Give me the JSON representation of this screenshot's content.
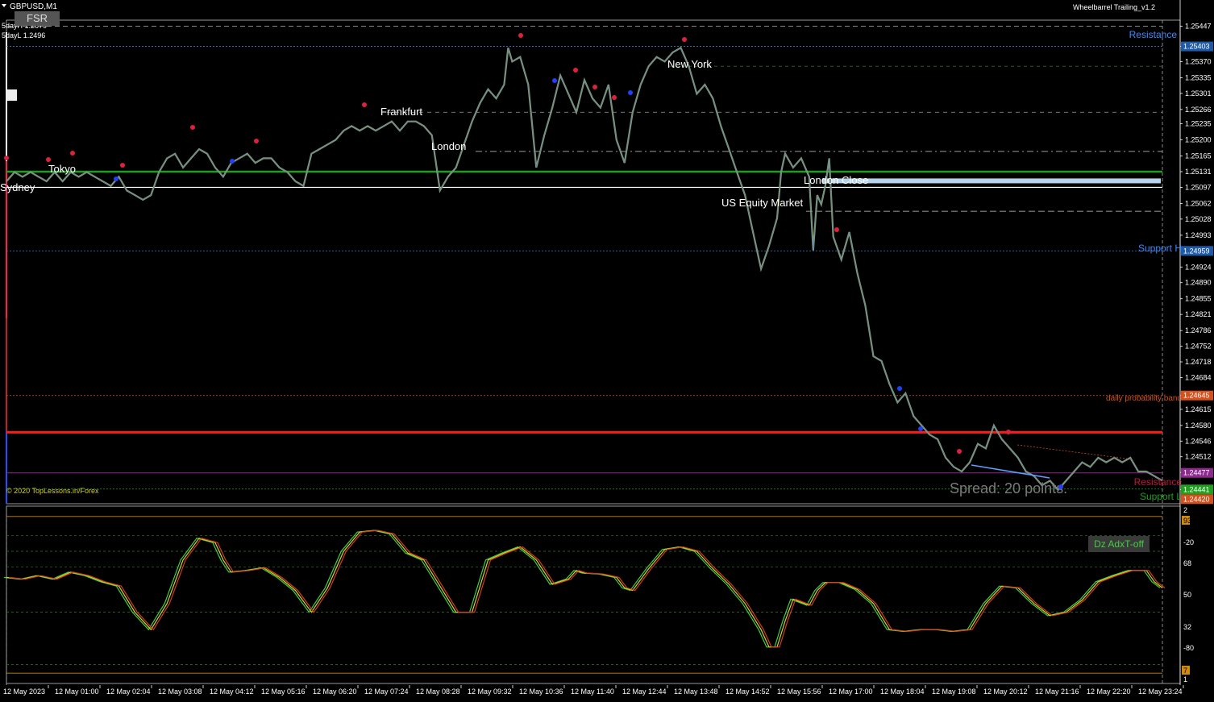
{
  "symbol_title": "GBPUSD,M1",
  "fsr_button": "FSR",
  "day_high_label": "5dayH 1.2679",
  "day_low_label": "5dayL 1.2496",
  "indicator_title": "Wheelbarrel Trailing_v1.2",
  "copyright": "© 2020 TopLessons.in/Forex",
  "spread_label": "Spread: 20 points.",
  "dz_badge": "Dz AdxT-off",
  "colors": {
    "background": "#000000",
    "price_line": "#8a9a5b",
    "green_line": "#1ea01e",
    "red_line": "#ff1a1a",
    "resistance_label": "#3a8cff",
    "osc_red": "#d43b22",
    "osc_green": "#3fcf3f",
    "osc_yellow": "#d6cf2a"
  },
  "chart_data": [
    {
      "type": "line",
      "title": "GBPUSD,M1",
      "y_ticks": [
        "1.25447",
        "1.25403",
        "1.25370",
        "1.25335",
        "1.25301",
        "1.25266",
        "1.25235",
        "1.25200",
        "1.25165",
        "1.25131",
        "1.25097",
        "1.25062",
        "1.25028",
        "1.24993",
        "1.24959",
        "1.24924",
        "1.24890",
        "1.24855",
        "1.24821",
        "1.24786",
        "1.24752",
        "1.24718",
        "1.24684",
        "1.24645",
        "1.24615",
        "1.24580",
        "1.24546",
        "1.24512",
        "1.24478",
        "1.24441",
        "1.24420"
      ],
      "ylim": [
        1.2441,
        1.2546
      ],
      "y_axis_tags": [
        {
          "text": "1.25403",
          "bg": "#1e5aa8"
        },
        {
          "text": "1.24959",
          "bg": "#1e5aa8"
        },
        {
          "text": "1.24645",
          "bg": "#d4501c"
        },
        {
          "text": "1.24477",
          "bg": "#8e2a8e"
        },
        {
          "text": "1.24441",
          "bg": "#1ea01e"
        },
        {
          "text": "1.24420",
          "bg": "#d4501c"
        }
      ],
      "x_ticks": [
        "12 May 2023",
        "12 May 01:00",
        "12 May 02:04",
        "12 May 03:08",
        "12 May 04:12",
        "12 May 05:16",
        "12 May 06:20",
        "12 May 07:24",
        "12 May 08:28",
        "12 May 09:32",
        "12 May 10:36",
        "12 May 11:40",
        "12 May 12:44",
        "12 May 13:48",
        "12 May 14:52",
        "12 May 15:56",
        "12 May 17:00",
        "12 May 18:04",
        "12 May 19:08",
        "12 May 20:12",
        "12 May 21:16",
        "12 May 22:20",
        "12 May 23:24"
      ],
      "session_labels": [
        "Sydney",
        "Tokyo",
        "Frankfurt",
        "London",
        "New York",
        "US Equity Market",
        "London Close"
      ],
      "line_labels": {
        "resistance": "Resistance",
        "support_h": "Support H",
        "daily_band": "daily probability band",
        "resistance_low": "Resistance",
        "support_low": "Support L"
      },
      "levels": {
        "resistance": 1.25403,
        "support_h": 1.24959,
        "daily_band": 1.24645,
        "green": 1.25131,
        "red": 1.24565,
        "purple": 1.24477,
        "white": 1.25097,
        "lightblue": 1.25111
      },
      "price_points": [
        [
          0,
          1.2511
        ],
        [
          10,
          1.2513
        ],
        [
          20,
          1.2512
        ],
        [
          30,
          1.2513
        ],
        [
          40,
          1.2512
        ],
        [
          50,
          1.2511
        ],
        [
          60,
          1.2513
        ],
        [
          70,
          1.2511
        ],
        [
          80,
          1.2513
        ],
        [
          90,
          1.2512
        ],
        [
          100,
          1.2513
        ],
        [
          110,
          1.2512
        ],
        [
          120,
          1.2511
        ],
        [
          130,
          1.251
        ],
        [
          140,
          1.2512
        ],
        [
          150,
          1.2509
        ],
        [
          160,
          1.2508
        ],
        [
          170,
          1.2507
        ],
        [
          180,
          1.2508
        ],
        [
          190,
          1.2513
        ],
        [
          200,
          1.2516
        ],
        [
          210,
          1.2517
        ],
        [
          220,
          1.2514
        ],
        [
          230,
          1.2516
        ],
        [
          240,
          1.2518
        ],
        [
          250,
          1.2517
        ],
        [
          260,
          1.2514
        ],
        [
          270,
          1.2512
        ],
        [
          280,
          1.2515
        ],
        [
          290,
          1.2516
        ],
        [
          300,
          1.2517
        ],
        [
          310,
          1.2515
        ],
        [
          320,
          1.2516
        ],
        [
          330,
          1.2516
        ],
        [
          340,
          1.2514
        ],
        [
          350,
          1.2513
        ],
        [
          360,
          1.2511
        ],
        [
          370,
          1.251
        ],
        [
          380,
          1.2517
        ],
        [
          390,
          1.2518
        ],
        [
          400,
          1.2519
        ],
        [
          410,
          1.252
        ],
        [
          420,
          1.2522
        ],
        [
          430,
          1.2523
        ],
        [
          440,
          1.2522
        ],
        [
          450,
          1.2523
        ],
        [
          460,
          1.2522
        ],
        [
          470,
          1.2523
        ],
        [
          480,
          1.2524
        ],
        [
          490,
          1.2522
        ],
        [
          500,
          1.2524
        ],
        [
          510,
          1.2524
        ],
        [
          520,
          1.2523
        ],
        [
          530,
          1.2521
        ],
        [
          540,
          1.2509
        ],
        [
          550,
          1.2512
        ],
        [
          560,
          1.2514
        ],
        [
          570,
          1.2519
        ],
        [
          580,
          1.2524
        ],
        [
          590,
          1.2528
        ],
        [
          600,
          1.2531
        ],
        [
          610,
          1.2529
        ],
        [
          620,
          1.2532
        ],
        [
          625,
          1.254
        ],
        [
          630,
          1.2537
        ],
        [
          640,
          1.2538
        ],
        [
          650,
          1.2532
        ],
        [
          660,
          1.2514
        ],
        [
          670,
          1.2521
        ],
        [
          680,
          1.2527
        ],
        [
          690,
          1.2534
        ],
        [
          700,
          1.253
        ],
        [
          710,
          1.2526
        ],
        [
          720,
          1.2533
        ],
        [
          730,
          1.2529
        ],
        [
          740,
          1.2527
        ],
        [
          750,
          1.2532
        ],
        [
          760,
          1.252
        ],
        [
          770,
          1.2515
        ],
        [
          780,
          1.2526
        ],
        [
          790,
          1.2532
        ],
        [
          800,
          1.2536
        ],
        [
          810,
          1.2538
        ],
        [
          820,
          1.2537
        ],
        [
          830,
          1.2539
        ],
        [
          840,
          1.254
        ],
        [
          850,
          1.2536
        ],
        [
          860,
          1.253
        ],
        [
          870,
          1.2532
        ],
        [
          880,
          1.2529
        ],
        [
          890,
          1.2523
        ],
        [
          900,
          1.2518
        ],
        [
          910,
          1.2513
        ],
        [
          920,
          1.2508
        ],
        [
          930,
          1.25
        ],
        [
          940,
          1.2492
        ],
        [
          950,
          1.2497
        ],
        [
          960,
          1.2503
        ],
        [
          965,
          1.2513
        ],
        [
          970,
          1.2517
        ],
        [
          980,
          1.2514
        ],
        [
          990,
          1.2516
        ],
        [
          1000,
          1.2512
        ],
        [
          1005,
          1.2496
        ],
        [
          1010,
          1.2508
        ],
        [
          1015,
          1.2506
        ],
        [
          1020,
          1.251
        ],
        [
          1025,
          1.2516
        ],
        [
          1030,
          1.2499
        ],
        [
          1040,
          1.2494
        ],
        [
          1050,
          1.25
        ],
        [
          1060,
          1.2491
        ],
        [
          1070,
          1.2484
        ],
        [
          1080,
          1.2473
        ],
        [
          1090,
          1.2472
        ],
        [
          1100,
          1.2467
        ],
        [
          1110,
          1.2463
        ],
        [
          1120,
          1.2465
        ],
        [
          1130,
          1.246
        ],
        [
          1140,
          1.2458
        ],
        [
          1150,
          1.2456
        ],
        [
          1160,
          1.2455
        ],
        [
          1170,
          1.2451
        ],
        [
          1180,
          1.2449
        ],
        [
          1190,
          1.2448
        ],
        [
          1200,
          1.245
        ],
        [
          1210,
          1.2454
        ],
        [
          1220,
          1.2453
        ],
        [
          1230,
          1.2458
        ],
        [
          1240,
          1.2455
        ],
        [
          1250,
          1.2453
        ],
        [
          1260,
          1.2451
        ],
        [
          1270,
          1.2448
        ],
        [
          1280,
          1.2447
        ],
        [
          1290,
          1.2445
        ],
        [
          1300,
          1.2446
        ],
        [
          1310,
          1.2444
        ],
        [
          1320,
          1.2446
        ],
        [
          1330,
          1.2448
        ],
        [
          1340,
          1.245
        ],
        [
          1350,
          1.2449
        ],
        [
          1360,
          1.2451
        ],
        [
          1370,
          1.245
        ],
        [
          1380,
          1.2451
        ],
        [
          1390,
          1.245
        ],
        [
          1400,
          1.2451
        ],
        [
          1410,
          1.2448
        ],
        [
          1420,
          1.2448
        ],
        [
          1430,
          1.2447
        ],
        [
          1440,
          1.2446
        ]
      ]
    },
    {
      "type": "line",
      "title": "Dz AdxT-off",
      "y_ticks": [
        "2",
        "93",
        "-20",
        "68",
        "50",
        "32",
        "-80",
        "7",
        "1"
      ],
      "ylim": [
        -100,
        100
      ],
      "series": [
        {
          "values": [
            [
              0,
              20
            ],
            [
              20,
              18
            ],
            [
              40,
              22
            ],
            [
              60,
              18
            ],
            [
              80,
              26
            ],
            [
              100,
              22
            ],
            [
              120,
              15
            ],
            [
              140,
              10
            ],
            [
              160,
              -20
            ],
            [
              180,
              -40
            ],
            [
              200,
              -10
            ],
            [
              220,
              40
            ],
            [
              240,
              65
            ],
            [
              260,
              60
            ],
            [
              270,
              40
            ],
            [
              280,
              26
            ],
            [
              300,
              28
            ],
            [
              320,
              31
            ],
            [
              340,
              20
            ],
            [
              360,
              5
            ],
            [
              380,
              -20
            ],
            [
              400,
              8
            ],
            [
              420,
              50
            ],
            [
              440,
              72
            ],
            [
              460,
              74
            ],
            [
              480,
              70
            ],
            [
              500,
              48
            ],
            [
              520,
              40
            ],
            [
              540,
              10
            ],
            [
              560,
              -20
            ],
            [
              580,
              -20
            ],
            [
              600,
              40
            ],
            [
              620,
              48
            ],
            [
              640,
              55
            ],
            [
              660,
              40
            ],
            [
              680,
              12
            ],
            [
              700,
              18
            ],
            [
              710,
              28
            ],
            [
              720,
              25
            ],
            [
              740,
              24
            ],
            [
              750,
              22
            ],
            [
              760,
              20
            ],
            [
              770,
              8
            ],
            [
              780,
              5
            ],
            [
              800,
              30
            ],
            [
              820,
              52
            ],
            [
              840,
              55
            ],
            [
              860,
              50
            ],
            [
              880,
              30
            ],
            [
              900,
              12
            ],
            [
              920,
              -10
            ],
            [
              940,
              -40
            ],
            [
              950,
              -60
            ],
            [
              960,
              -60
            ],
            [
              970,
              -30
            ],
            [
              980,
              -5
            ],
            [
              1000,
              -12
            ],
            [
              1010,
              5
            ],
            [
              1020,
              14
            ],
            [
              1040,
              14
            ],
            [
              1060,
              6
            ],
            [
              1080,
              -10
            ],
            [
              1100,
              -40
            ],
            [
              1120,
              -42
            ],
            [
              1140,
              -40
            ],
            [
              1160,
              -40
            ],
            [
              1180,
              -42
            ],
            [
              1200,
              -40
            ],
            [
              1220,
              -10
            ],
            [
              1240,
              10
            ],
            [
              1260,
              8
            ],
            [
              1280,
              -10
            ],
            [
              1300,
              -24
            ],
            [
              1320,
              -20
            ],
            [
              1340,
              -6
            ],
            [
              1360,
              15
            ],
            [
              1380,
              22
            ],
            [
              1400,
              28
            ],
            [
              1420,
              28
            ],
            [
              1430,
              15
            ],
            [
              1440,
              8
            ]
          ]
        }
      ]
    }
  ]
}
